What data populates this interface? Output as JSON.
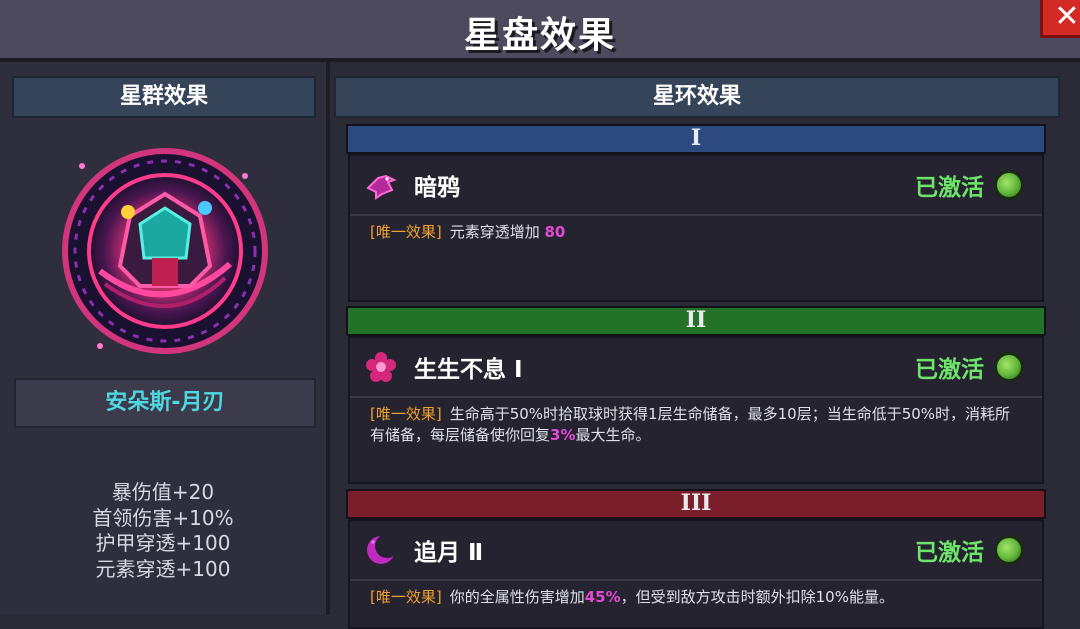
{
  "window": {
    "title": "星盘效果",
    "close_icon": "close-x-icon"
  },
  "left_panel": {
    "header": "星群效果",
    "hero_name": "安朵斯-月刃",
    "stats": [
      "暴伤值+20",
      "首领伤害+10%",
      "护甲穿透+100",
      "元素穿透+100"
    ]
  },
  "right_panel": {
    "header": "星环效果",
    "rings": [
      {
        "numeral": "I",
        "color": "#2c4a80",
        "name": "暗鸦",
        "icon": "crow-icon",
        "status": "已激活",
        "tag": "[唯一效果]",
        "desc_parts": [
          "元素穿透增加 ",
          "80",
          ""
        ]
      },
      {
        "numeral": "II",
        "color": "#237227",
        "name": "生生不息 Ⅰ",
        "icon": "flower-icon",
        "status": "已激活",
        "tag": "[唯一效果]",
        "desc_parts": [
          "生命高于50%时拾取球时获得1层生命储备，最多10层；当生命低于50%时，消耗所有储备，每层储备使你回复",
          "3%",
          "最大生命。"
        ]
      },
      {
        "numeral": "III",
        "color": "#7a1e2a",
        "name": "追月 Ⅱ",
        "icon": "crescent-moon-icon",
        "status": "已激活",
        "tag": "[唯一效果]",
        "desc_parts": [
          "你的全属性伤害增加",
          "45%",
          "，但受到敌方攻击时额外扣除10%能量。"
        ]
      }
    ]
  }
}
